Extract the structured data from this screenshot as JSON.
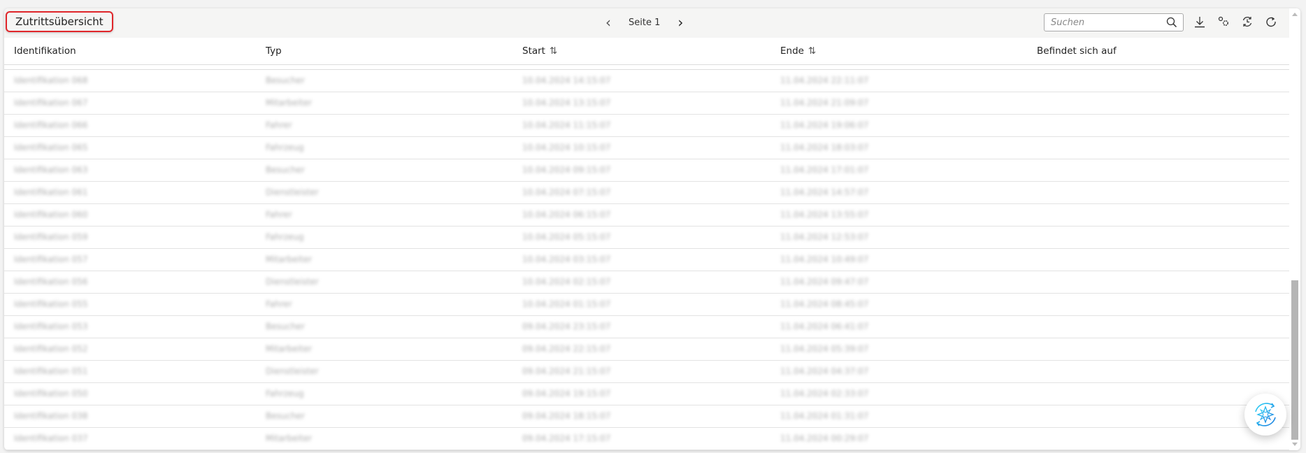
{
  "header": {
    "title": "Zutrittsübersicht",
    "page_label": "Seite 1",
    "search_placeholder": "Suchen"
  },
  "columns": {
    "id": "Identifikation",
    "type": "Typ",
    "start": "Start",
    "end": "Ende",
    "location": "Befindet sich auf"
  },
  "rows": [
    {
      "id": "Identifikation 068",
      "type": "Besucher",
      "start": "10.04.2024 14:15:07",
      "end": "11.04.2024 22:11:07",
      "location": ""
    },
    {
      "id": "Identifikation 067",
      "type": "Mitarbeiter",
      "start": "10.04.2024 13:15:07",
      "end": "11.04.2024 21:09:07",
      "location": ""
    },
    {
      "id": "Identifikation 066",
      "type": "Fahrer",
      "start": "10.04.2024 11:15:07",
      "end": "11.04.2024 19:06:07",
      "location": ""
    },
    {
      "id": "Identifikation 065",
      "type": "Fahrzeug",
      "start": "10.04.2024 10:15:07",
      "end": "11.04.2024 18:03:07",
      "location": ""
    },
    {
      "id": "Identifikation 063",
      "type": "Besucher",
      "start": "10.04.2024 09:15:07",
      "end": "11.04.2024 17:01:07",
      "location": ""
    },
    {
      "id": "Identifikation 061",
      "type": "Dienstleister",
      "start": "10.04.2024 07:15:07",
      "end": "11.04.2024 14:57:07",
      "location": ""
    },
    {
      "id": "Identifikation 060",
      "type": "Fahrer",
      "start": "10.04.2024 06:15:07",
      "end": "11.04.2024 13:55:07",
      "location": ""
    },
    {
      "id": "Identifikation 059",
      "type": "Fahrzeug",
      "start": "10.04.2024 05:15:07",
      "end": "11.04.2024 12:53:07",
      "location": ""
    },
    {
      "id": "Identifikation 057",
      "type": "Mitarbeiter",
      "start": "10.04.2024 03:15:07",
      "end": "11.04.2024 10:49:07",
      "location": ""
    },
    {
      "id": "Identifikation 056",
      "type": "Dienstleister",
      "start": "10.04.2024 02:15:07",
      "end": "11.04.2024 09:47:07",
      "location": ""
    },
    {
      "id": "Identifikation 055",
      "type": "Fahrer",
      "start": "10.04.2024 01:15:07",
      "end": "11.04.2024 08:45:07",
      "location": ""
    },
    {
      "id": "Identifikation 053",
      "type": "Besucher",
      "start": "09.04.2024 23:15:07",
      "end": "11.04.2024 06:41:07",
      "location": ""
    },
    {
      "id": "Identifikation 052",
      "type": "Mitarbeiter",
      "start": "09.04.2024 22:15:07",
      "end": "11.04.2024 05:39:07",
      "location": ""
    },
    {
      "id": "Identifikation 051",
      "type": "Dienstleister",
      "start": "09.04.2024 21:15:07",
      "end": "11.04.2024 04:37:07",
      "location": ""
    },
    {
      "id": "Identifikation 050",
      "type": "Fahrzeug",
      "start": "09.04.2024 19:15:07",
      "end": "11.04.2024 02:33:07",
      "location": ""
    },
    {
      "id": "Identifikation 038",
      "type": "Besucher",
      "start": "09.04.2024 18:15:07",
      "end": "11.04.2024 01:31:07",
      "location": ""
    },
    {
      "id": "Identifikation 037",
      "type": "Mitarbeiter",
      "start": "09.04.2024 17:15:07",
      "end": "11.04.2024 00:29:07",
      "location": ""
    }
  ],
  "colors": {
    "title_border": "#e0262b",
    "fab_gradient_start": "#2bb5f0",
    "fab_gradient_end": "#1c7fe0"
  }
}
